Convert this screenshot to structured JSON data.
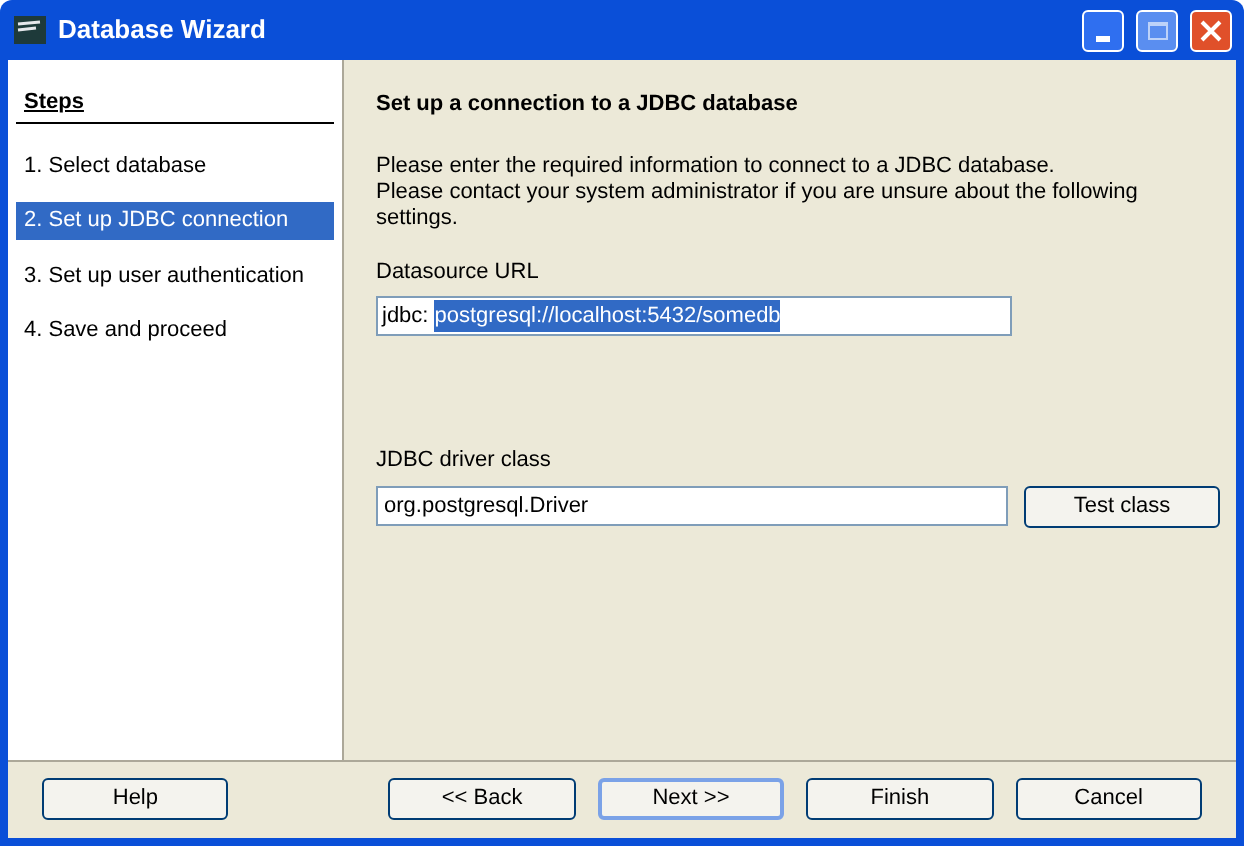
{
  "window": {
    "title": "Database Wizard"
  },
  "steps": {
    "heading": "Steps",
    "items": [
      {
        "label": "1. Select database",
        "selected": false
      },
      {
        "label": "2. Set up JDBC connection",
        "selected": true
      },
      {
        "label": "3. Set up user authentication",
        "selected": false
      },
      {
        "label": "4. Save and proceed",
        "selected": false
      }
    ]
  },
  "page": {
    "title": "Set up a connection to a JDBC database",
    "description": [
      "Please enter the required information to connect to a JDBC database.",
      "Please contact your system administrator if you are unsure about the following settings."
    ],
    "datasource": {
      "label": "Datasource URL",
      "prefix": "jdbc:",
      "value": "postgresql://localhost:5432/somedb",
      "selected": true
    },
    "driver": {
      "label": "JDBC driver class",
      "value": "org.postgresql.Driver",
      "button": "Test class"
    }
  },
  "buttons": [
    {
      "label": "Help",
      "default": false
    },
    {
      "label": "<< Back",
      "default": false
    },
    {
      "label": "Next >>",
      "default": true
    },
    {
      "label": "Finish",
      "default": false
    },
    {
      "label": "Cancel",
      "default": false
    }
  ]
}
